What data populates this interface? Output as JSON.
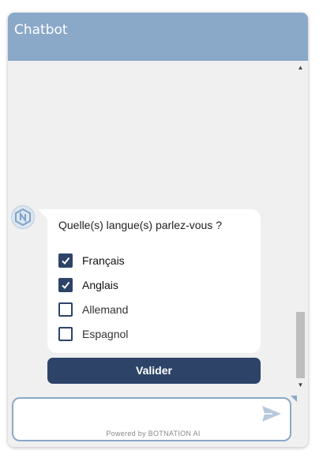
{
  "header": {
    "title": "Chatbot"
  },
  "message": {
    "question": "Quelle(s) langue(s) parlez-vous ?",
    "options": [
      {
        "label": "Français",
        "checked": true
      },
      {
        "label": "Anglais",
        "checked": true
      },
      {
        "label": "Allemand",
        "checked": false
      },
      {
        "label": "Espagnol",
        "checked": false
      }
    ],
    "submit_label": "Valider"
  },
  "composer": {
    "value": "",
    "placeholder": "",
    "powered_by": "Powered by BOTNATION AI"
  },
  "colors": {
    "header": "#8aa8c8",
    "accent": "#2d4468",
    "background": "#f0f0f0"
  },
  "icons": {
    "avatar": "botnation-logo-icon",
    "send": "send-icon",
    "check": "check-icon"
  }
}
